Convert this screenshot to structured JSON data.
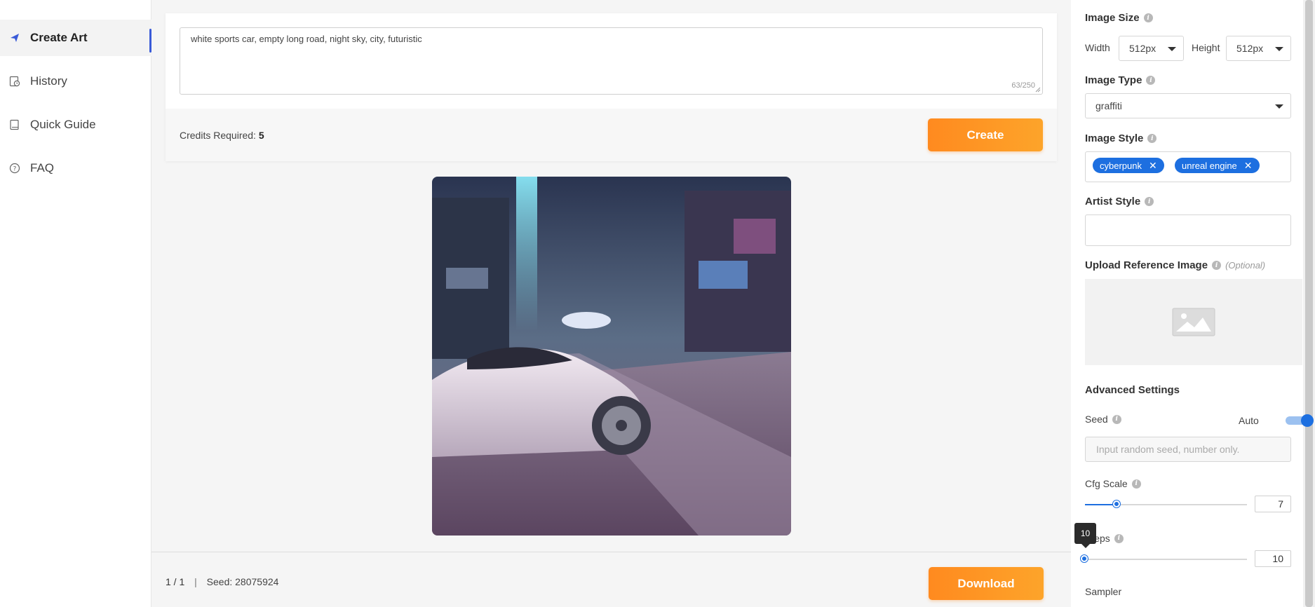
{
  "sidebar": {
    "items": [
      {
        "label": "Create Art",
        "icon": "paper-plane-icon",
        "active": true
      },
      {
        "label": "History",
        "icon": "history-icon"
      },
      {
        "label": "Quick Guide",
        "icon": "book-icon"
      },
      {
        "label": "FAQ",
        "icon": "question-circle-icon"
      }
    ]
  },
  "prompt": {
    "text": "white sports car, empty long road, night sky, city, futuristic",
    "count": "63/250",
    "credits_label": "Credits Required:",
    "credits_value": "5",
    "create_label": "Create"
  },
  "result": {
    "pager": "1 / 1",
    "separator": "|",
    "seed_text": "Seed: 28075924",
    "download_label": "Download"
  },
  "panel": {
    "image_size": {
      "label": "Image Size",
      "width_label": "Width",
      "width_value": "512px",
      "height_label": "Height",
      "height_value": "512px"
    },
    "image_type": {
      "label": "Image Type",
      "value": "graffiti"
    },
    "image_style": {
      "label": "Image Style",
      "tags": [
        "cyberpunk",
        "unreal engine"
      ]
    },
    "artist_style": {
      "label": "Artist Style"
    },
    "upload": {
      "label": "Upload Reference Image",
      "optional": "(Optional)"
    },
    "advanced": {
      "label": "Advanced Settings"
    },
    "seed": {
      "label": "Seed",
      "auto_label": "Auto",
      "placeholder": "Input random seed, number only.",
      "auto_on": true
    },
    "cfg": {
      "label": "Cfg Scale",
      "value": "7",
      "fraction": 0.2
    },
    "steps": {
      "label": "Steps",
      "value": "10",
      "fraction": 0.0,
      "tooltip": "10"
    },
    "sampler": {
      "label": "Sampler"
    }
  },
  "colors": {
    "accent": "#1d6fe0",
    "orange": "#ff8a1f",
    "nav_active": "#3a5bd8"
  }
}
